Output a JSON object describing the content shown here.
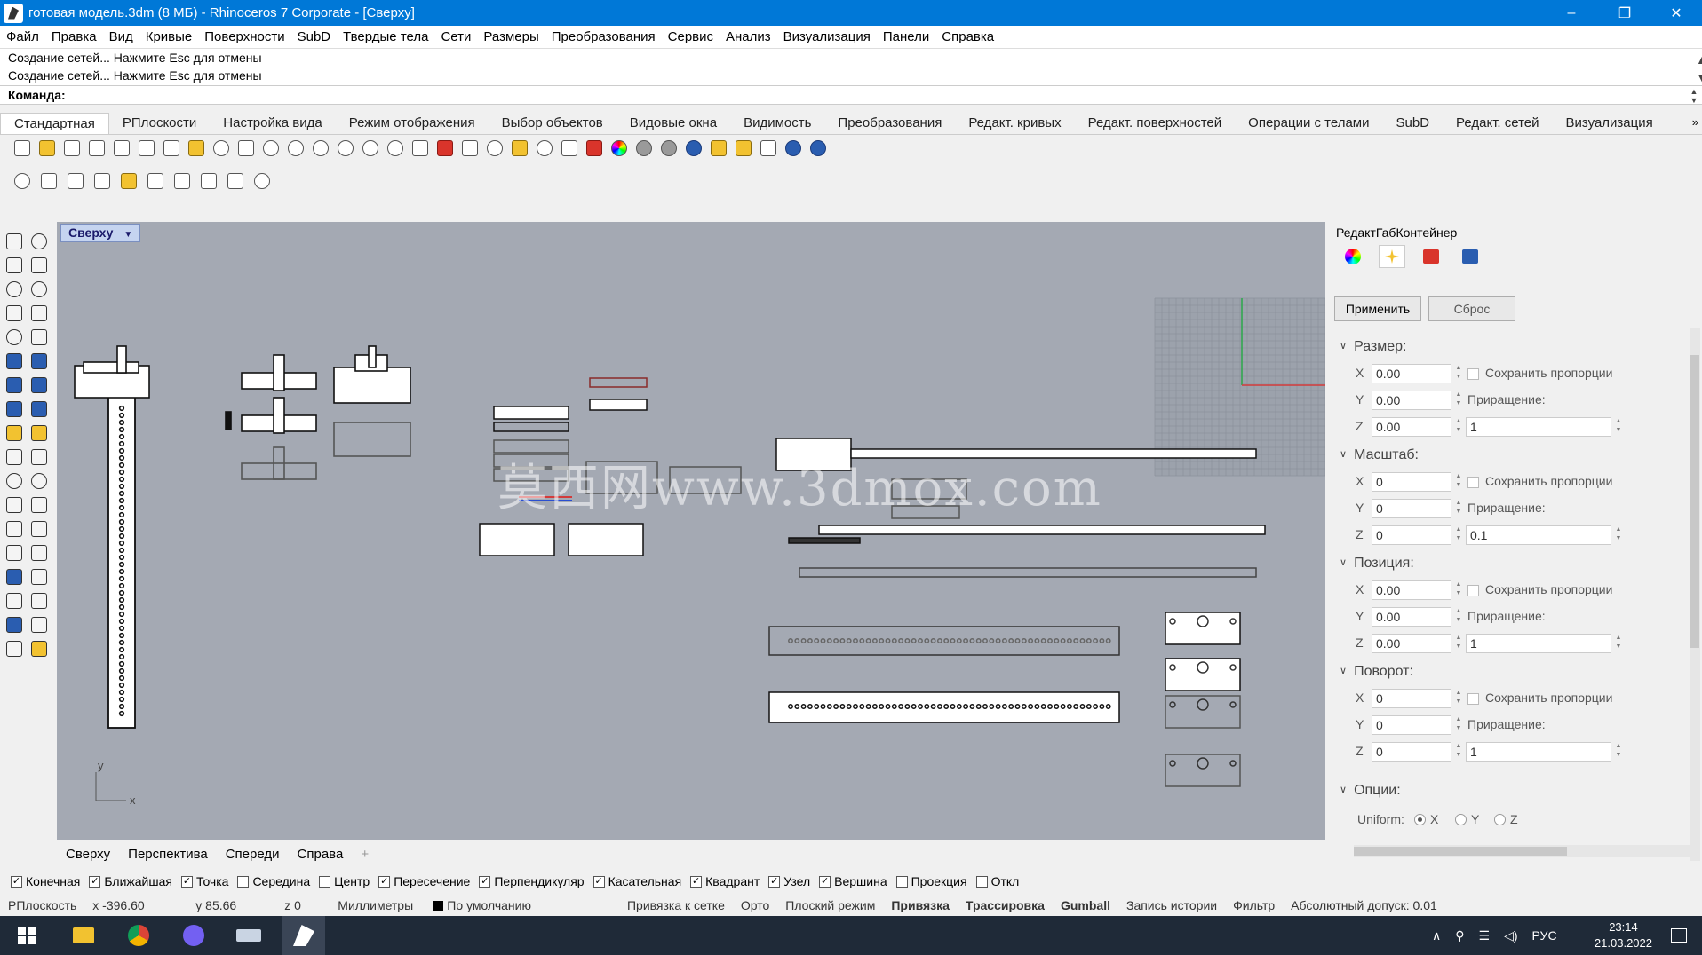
{
  "window": {
    "title": "готовая модель.3dm (8 МБ) - Rhinoceros 7 Corporate - [Сверху]",
    "minimize": "–",
    "maximize": "❐",
    "close": "✕"
  },
  "menu": [
    "Файл",
    "Правка",
    "Вид",
    "Кривые",
    "Поверхности",
    "SubD",
    "Твердые тела",
    "Сети",
    "Размеры",
    "Преобразования",
    "Сервис",
    "Анализ",
    "Визуализация",
    "Панели",
    "Справка"
  ],
  "command_history": [
    "Создание сетей... Нажмите Esc для отмены",
    "Создание сетей... Нажмите Esc для отмены"
  ],
  "command_prompt": "Команда:",
  "toolbar_tabs": [
    "Стандартная",
    "РПлоскости",
    "Настройка вида",
    "Режим отображения",
    "Выбор объектов",
    "Видовые окна",
    "Видимость",
    "Преобразования",
    "Редакт. кривых",
    "Редакт. поверхностей",
    "Операции с телами",
    "SubD",
    "Редакт. сетей",
    "Визуализация"
  ],
  "toolbar_tabs_more": "»",
  "viewport": {
    "name": "Сверху",
    "axis_x": "x",
    "axis_y": "y"
  },
  "watermark": "莫西网www.3dmox.com",
  "viewport_tabs": [
    "Сверху",
    "Перспектива",
    "Спереди",
    "Справа"
  ],
  "viewport_tab_add": "+",
  "panel": {
    "title": "РедактГабКонтейнер",
    "apply": "Применить",
    "reset": "Сброс",
    "sections": [
      {
        "name": "Размер:",
        "x": "0.00",
        "y": "0.00",
        "z": "0.00",
        "keep": "Сохранить пропорции",
        "inc_label": "Приращение:",
        "inc": "1"
      },
      {
        "name": "Масштаб:",
        "x": "0",
        "y": "0",
        "z": "0",
        "keep": "Сохранить пропорции",
        "inc_label": "Приращение:",
        "inc": "0.1"
      },
      {
        "name": "Позиция:",
        "x": "0.00",
        "y": "0.00",
        "z": "0.00",
        "keep": "Сохранить пропорции",
        "inc_label": "Приращение:",
        "inc": "1"
      },
      {
        "name": "Поворот:",
        "x": "0",
        "y": "0",
        "z": "0",
        "keep": "Сохранить пропорции",
        "inc_label": "Приращение:",
        "inc": "1"
      }
    ],
    "options": {
      "name": "Опции:",
      "uniform": "Uniform:",
      "x": "X",
      "y": "Y",
      "z": "Z"
    }
  },
  "axis_letters": [
    "X",
    "Y",
    "Z"
  ],
  "osnaps": [
    {
      "label": "Конечная",
      "checked": true
    },
    {
      "label": "Ближайшая",
      "checked": true
    },
    {
      "label": "Точка",
      "checked": true
    },
    {
      "label": "Середина",
      "checked": false
    },
    {
      "label": "Центр",
      "checked": false
    },
    {
      "label": "Пересечение",
      "checked": true
    },
    {
      "label": "Перпендикуляр",
      "checked": true
    },
    {
      "label": "Касательная",
      "checked": true
    },
    {
      "label": "Квадрант",
      "checked": true
    },
    {
      "label": "Узел",
      "checked": true
    },
    {
      "label": "Вершина",
      "checked": true
    },
    {
      "label": "Проекция",
      "checked": false
    },
    {
      "label": "Откл",
      "checked": false
    }
  ],
  "status": {
    "cplane": "РПлоскость",
    "x": "x -396.60",
    "y": "y 85.66",
    "z": "z 0",
    "units": "Миллиметры",
    "layer": "По умолчанию",
    "items": [
      "Привязка к сетке",
      "Орто",
      "Плоский режим"
    ],
    "bold_items": [
      "Привязка",
      "Трассировка",
      "Gumball"
    ],
    "tail": [
      "Запись истории",
      "Фильтр",
      "Абсолютный допуск: 0.01"
    ]
  },
  "taskbar": {
    "lang": "РУС",
    "time": "23:14",
    "date": "21.03.2022"
  },
  "colors": {
    "title": "#0078d7",
    "viewport": "#a4a9b3",
    "taskbar": "#1f2a38"
  }
}
